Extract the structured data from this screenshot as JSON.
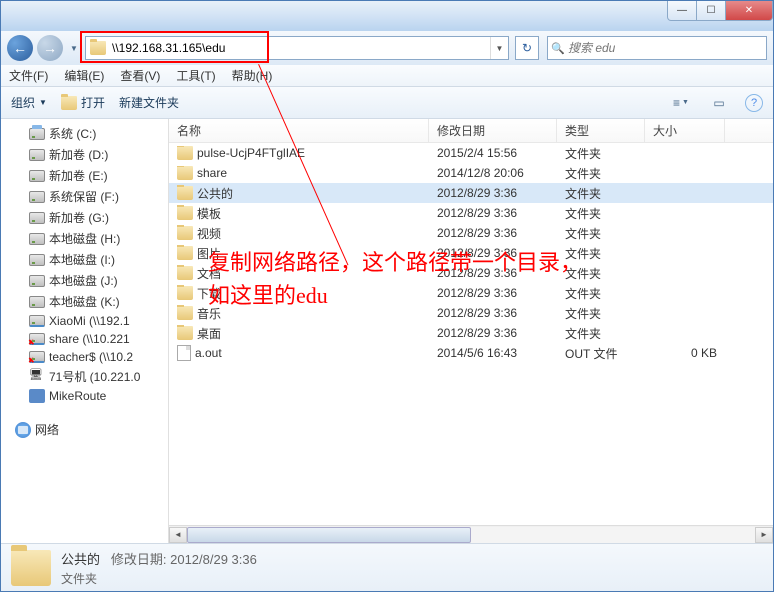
{
  "titlebar": {
    "min": "—",
    "max": "☐",
    "close": "✕"
  },
  "nav": {
    "back": "←",
    "fwd": "→",
    "drop": "▼"
  },
  "address": {
    "path": "\\\\192.168.31.165\\edu",
    "drop": "▼",
    "refresh": "↻"
  },
  "search": {
    "placeholder": "搜索 edu",
    "icon": "🔍"
  },
  "menu": {
    "file": "文件(F)",
    "edit": "编辑(E)",
    "view": "查看(V)",
    "tools": "工具(T)",
    "help": "帮助(H)"
  },
  "toolbar": {
    "organize": "组织",
    "open": "打开",
    "newfolder": "新建文件夹",
    "drop": "▼",
    "view": "≡",
    "preview": "▭",
    "help": "?"
  },
  "columns": {
    "name": "名称",
    "date": "修改日期",
    "type": "类型",
    "size": "大小"
  },
  "sidebar": {
    "items": [
      {
        "label": "系统 (C:)",
        "icon": "sys"
      },
      {
        "label": "新加卷 (D:)",
        "icon": "drive"
      },
      {
        "label": "新加卷 (E:)",
        "icon": "drive"
      },
      {
        "label": "系统保留 (F:)",
        "icon": "drive"
      },
      {
        "label": "新加卷 (G:)",
        "icon": "drive"
      },
      {
        "label": "本地磁盘 (H:)",
        "icon": "drive"
      },
      {
        "label": "本地磁盘 (I:)",
        "icon": "drive"
      },
      {
        "label": "本地磁盘 (J:)",
        "icon": "drive"
      },
      {
        "label": "本地磁盘 (K:)",
        "icon": "drive"
      },
      {
        "label": "XiaoMi (\\\\192.1",
        "icon": "net"
      },
      {
        "label": "share (\\\\10.221",
        "icon": "netx"
      },
      {
        "label": "teacher$ (\\\\10.2",
        "icon": "netx"
      },
      {
        "label": "71号机 (10.221.0",
        "icon": "pc"
      },
      {
        "label": "MikeRoute",
        "icon": "route"
      }
    ],
    "network": "网络"
  },
  "files": [
    {
      "name": "pulse-UcjP4FTglIAE",
      "date": "2015/2/4 15:56",
      "type": "文件夹",
      "size": "",
      "icon": "folder"
    },
    {
      "name": "share",
      "date": "2014/12/8 20:06",
      "type": "文件夹",
      "size": "",
      "icon": "folder"
    },
    {
      "name": "公共的",
      "date": "2012/8/29 3:36",
      "type": "文件夹",
      "size": "",
      "icon": "folder",
      "sel": true
    },
    {
      "name": "模板",
      "date": "2012/8/29 3:36",
      "type": "文件夹",
      "size": "",
      "icon": "folder"
    },
    {
      "name": "视频",
      "date": "2012/8/29 3:36",
      "type": "文件夹",
      "size": "",
      "icon": "folder"
    },
    {
      "name": "图片",
      "date": "2012/8/29 3:36",
      "type": "文件夹",
      "size": "",
      "icon": "folder"
    },
    {
      "name": "文档",
      "date": "2012/8/29 3:36",
      "type": "文件夹",
      "size": "",
      "icon": "folder"
    },
    {
      "name": "下载",
      "date": "2012/8/29 3:36",
      "type": "文件夹",
      "size": "",
      "icon": "folder"
    },
    {
      "name": "音乐",
      "date": "2012/8/29 3:36",
      "type": "文件夹",
      "size": "",
      "icon": "folder"
    },
    {
      "name": "桌面",
      "date": "2012/8/29 3:36",
      "type": "文件夹",
      "size": "",
      "icon": "folder"
    },
    {
      "name": "a.out",
      "date": "2014/5/6 16:43",
      "type": "OUT 文件",
      "size": "0 KB",
      "icon": "file"
    }
  ],
  "details": {
    "name": "公共的",
    "meta_label": "修改日期:",
    "meta_value": "2012/8/29 3:36",
    "type": "文件夹"
  },
  "annotation": {
    "line1": "复制网络路径，这个路径带一个目录，",
    "line2": "如这里的edu"
  }
}
